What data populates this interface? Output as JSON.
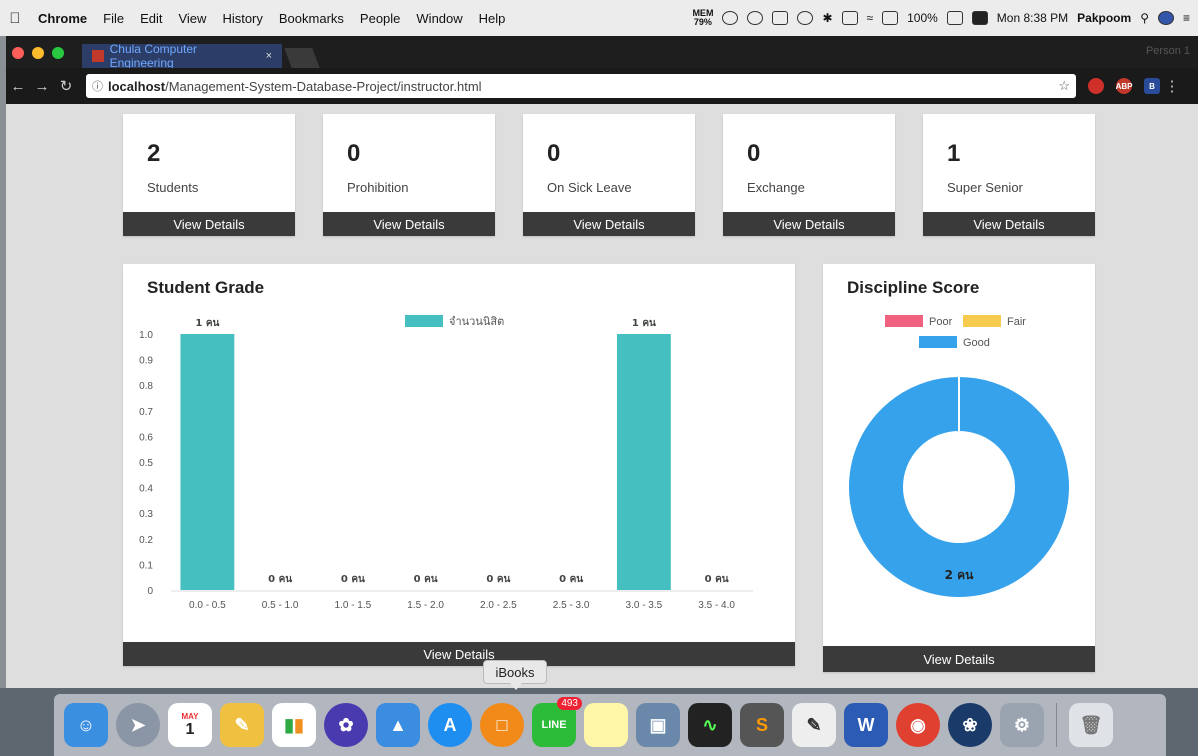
{
  "menubar": {
    "app": "Chrome",
    "items": [
      "File",
      "Edit",
      "View",
      "History",
      "Bookmarks",
      "People",
      "Window",
      "Help"
    ],
    "mem_label": "MEM",
    "mem_value": "79%",
    "battery": "100%",
    "clock": "Mon 8:38 PM",
    "user": "Pakpoom"
  },
  "browser": {
    "tab_title": "Chula Computer Engineering",
    "tab_close": "×",
    "profile": "Person 1",
    "url_host": "localhost",
    "url_path": "/Management-System-Database-Project/instructor.html",
    "ext_abp": "ABP",
    "ext_b": "B"
  },
  "stats": [
    {
      "value": "2",
      "label": "Students",
      "action": "View Details"
    },
    {
      "value": "0",
      "label": "Prohibition",
      "action": "View Details"
    },
    {
      "value": "0",
      "label": "On Sick Leave",
      "action": "View Details"
    },
    {
      "value": "0",
      "label": "Exchange",
      "action": "View Details"
    },
    {
      "value": "1",
      "label": "Super Senior",
      "action": "View Details"
    }
  ],
  "grade_panel": {
    "title": "Student Grade",
    "action": "View Details"
  },
  "discipline_panel": {
    "title": "Discipline Score",
    "action": "View Details"
  },
  "chart_data": [
    {
      "type": "bar",
      "title": "Student Grade",
      "categories": [
        "0.0 - 0.5",
        "0.5 - 1.0",
        "1.0 - 1.5",
        "1.5 - 2.0",
        "2.0 - 2.5",
        "2.5 - 3.0",
        "3.0 - 3.5",
        "3.5 - 4.0"
      ],
      "series": [
        {
          "name": "จำนวนนิสิต",
          "values": [
            1,
            0,
            0,
            0,
            0,
            0,
            1,
            0
          ],
          "color": "#45bfbf"
        }
      ],
      "data_labels": [
        "1 คน",
        "0 คน",
        "0 คน",
        "0 คน",
        "0 คน",
        "0 คน",
        "1 คน",
        "0 คน"
      ],
      "y_ticks": [
        "0",
        "0.1",
        "0.2",
        "0.3",
        "0.4",
        "0.5",
        "0.6",
        "0.7",
        "0.8",
        "0.9",
        "1.0"
      ],
      "ylim": [
        0,
        1
      ],
      "legend": "top",
      "grid": false
    },
    {
      "type": "pie",
      "title": "Discipline Score",
      "categories": [
        "Poor",
        "Fair",
        "Good"
      ],
      "values": [
        0,
        0,
        2
      ],
      "colors": [
        "#f0607f",
        "#f7cb4d",
        "#35a2eb"
      ],
      "data_label": "2 คน",
      "legend": "top"
    }
  ],
  "dock": {
    "tooltip": "iBooks",
    "line_badge": "493",
    "calendar_month": "MAY",
    "calendar_day": "1"
  }
}
